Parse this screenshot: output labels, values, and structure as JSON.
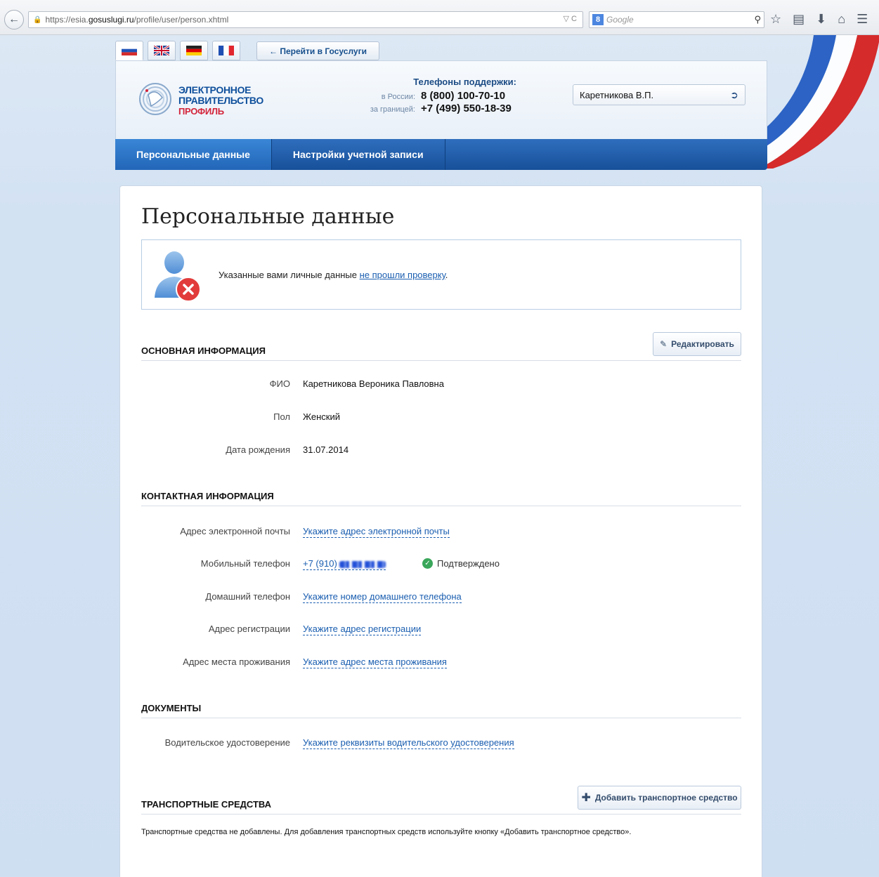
{
  "browser": {
    "url_prefix": "https://esia.",
    "url_host": "gosuslugi.ru",
    "url_path": "/profile/user/person.xhtml",
    "url_tools": "▽ C",
    "search_placeholder": "Google",
    "search_engine_icon": "8"
  },
  "header": {
    "languages": [
      "ru",
      "en",
      "de",
      "fr"
    ],
    "goto_button": "← Перейти в Госуслуги",
    "logo": {
      "line1": "ЭЛЕКТРОННОЕ",
      "line2": "ПРАВИТЕЛЬСТВО",
      "line3": "ПРОФИЛЬ"
    },
    "support": {
      "title": "Телефоны поддержки:",
      "russia_label": "в России:",
      "russia_phone": "8 (800) 100-70-10",
      "abroad_label": "за границей:",
      "abroad_phone": "+7 (499) 550-18-39"
    },
    "user_name": "Каретникова В.П."
  },
  "nav": {
    "tabs": [
      {
        "label": "Персональные данные",
        "active": true
      },
      {
        "label": "Настройки учетной записи",
        "active": false
      }
    ]
  },
  "main": {
    "title": "Персональные данные",
    "warning": {
      "text": "Указанные вами личные данные ",
      "link": "не прошли проверку",
      "suffix": "."
    },
    "basic": {
      "heading": "ОСНОВНАЯ ИНФОРМАЦИЯ",
      "edit_button": "Редактировать",
      "fields": {
        "fio_label": "ФИО",
        "fio_value": "Каретникова Вероника Павловна",
        "gender_label": "Пол",
        "gender_value": "Женский",
        "birth_label": "Дата рождения",
        "birth_value": "31.07.2014"
      }
    },
    "contacts": {
      "heading": "КОНТАКТНАЯ ИНФОРМАЦИЯ",
      "email_label": "Адрес электронной почты",
      "email_link": "Укажите адрес электронной почты",
      "mobile_label": "Мобильный телефон",
      "mobile_value": "+7 (910)",
      "mobile_status": "Подтверждено",
      "home_label": "Домашний телефон",
      "home_link": "Укажите номер домашнего телефона",
      "reg_label": "Адрес регистрации",
      "reg_link": "Укажите адрес регистрации",
      "live_label": "Адрес места проживания",
      "live_link": "Укажите адрес места проживания"
    },
    "documents": {
      "heading": "ДОКУМЕНТЫ",
      "license_label": "Водительское удостоверение",
      "license_link": "Укажите реквизиты водительского удостоверения"
    },
    "vehicles": {
      "heading": "ТРАНСПОРТНЫЕ СРЕДСТВА",
      "add_button": "Добавить транспортное средство",
      "note": "Транспортные средства не добавлены. Для добавления транспортных средств используйте кнопку «Добавить транспортное средство»."
    }
  },
  "colors": {
    "link": "#1a5eb0",
    "nav_blue": "#17509a",
    "brand_red": "#d3243a",
    "verified_green": "#3aa65a"
  }
}
